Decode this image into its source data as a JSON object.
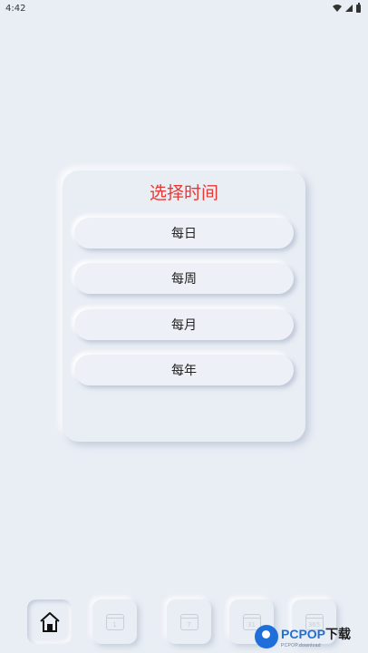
{
  "status_bar": {
    "time": "4:42"
  },
  "dialog": {
    "title": "选择时间",
    "options": [
      "每日",
      "每周",
      "每月",
      "每年"
    ]
  },
  "bottom_nav": {
    "items": [
      {
        "icon": "home-icon",
        "active": true
      },
      {
        "icon": "calendar-day-icon",
        "label": "1"
      },
      {
        "icon": "calendar-week-icon",
        "label": "7"
      },
      {
        "icon": "calendar-month-icon",
        "label": "31"
      },
      {
        "icon": "calendar-year-icon",
        "label": "365"
      }
    ]
  },
  "watermark": {
    "brand": "PCPOP",
    "brand_cn": "下载",
    "sub": "PCPOP.download"
  },
  "colors": {
    "background": "#e9edf4",
    "title": "#e53935",
    "brand": "#1e6fd9"
  }
}
